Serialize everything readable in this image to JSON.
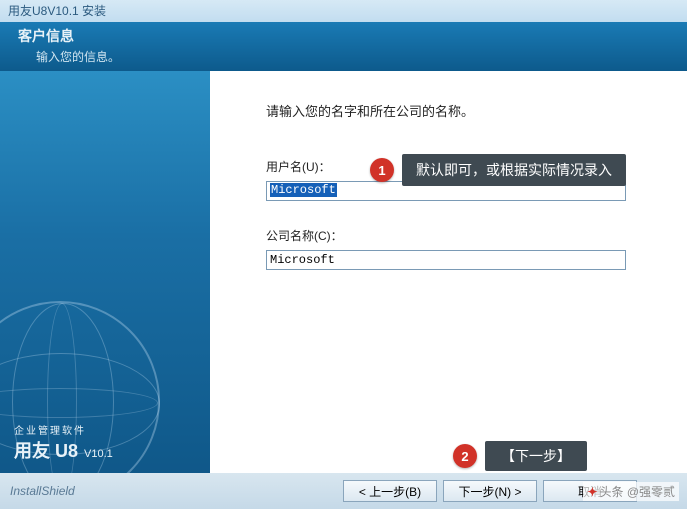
{
  "window": {
    "title": "用友U8V10.1 安装"
  },
  "header": {
    "title": "客户信息",
    "subtitle": "输入您的信息。"
  },
  "sidebar": {
    "brand_sub": "企业管理软件",
    "brand_main": "用友 U8",
    "brand_version": "V10.1"
  },
  "main": {
    "prompt": "请输入您的名字和所在公司的名称。",
    "username_label": "用户名(U)：",
    "username_value": "Microsoft",
    "company_label": "公司名称(C)：",
    "company_value": "Microsoft"
  },
  "callouts": {
    "c1_num": "1",
    "c1_text": "默认即可，或根据实际情况录入",
    "c2_num": "2",
    "c2_text": "【下一步】"
  },
  "footer": {
    "brand": "InstallShield",
    "back": "< 上一步(B)",
    "next": "下一步(N) >",
    "cancel": "取消"
  },
  "watermark": {
    "prefix": "头条",
    "author": "@强零贰"
  }
}
